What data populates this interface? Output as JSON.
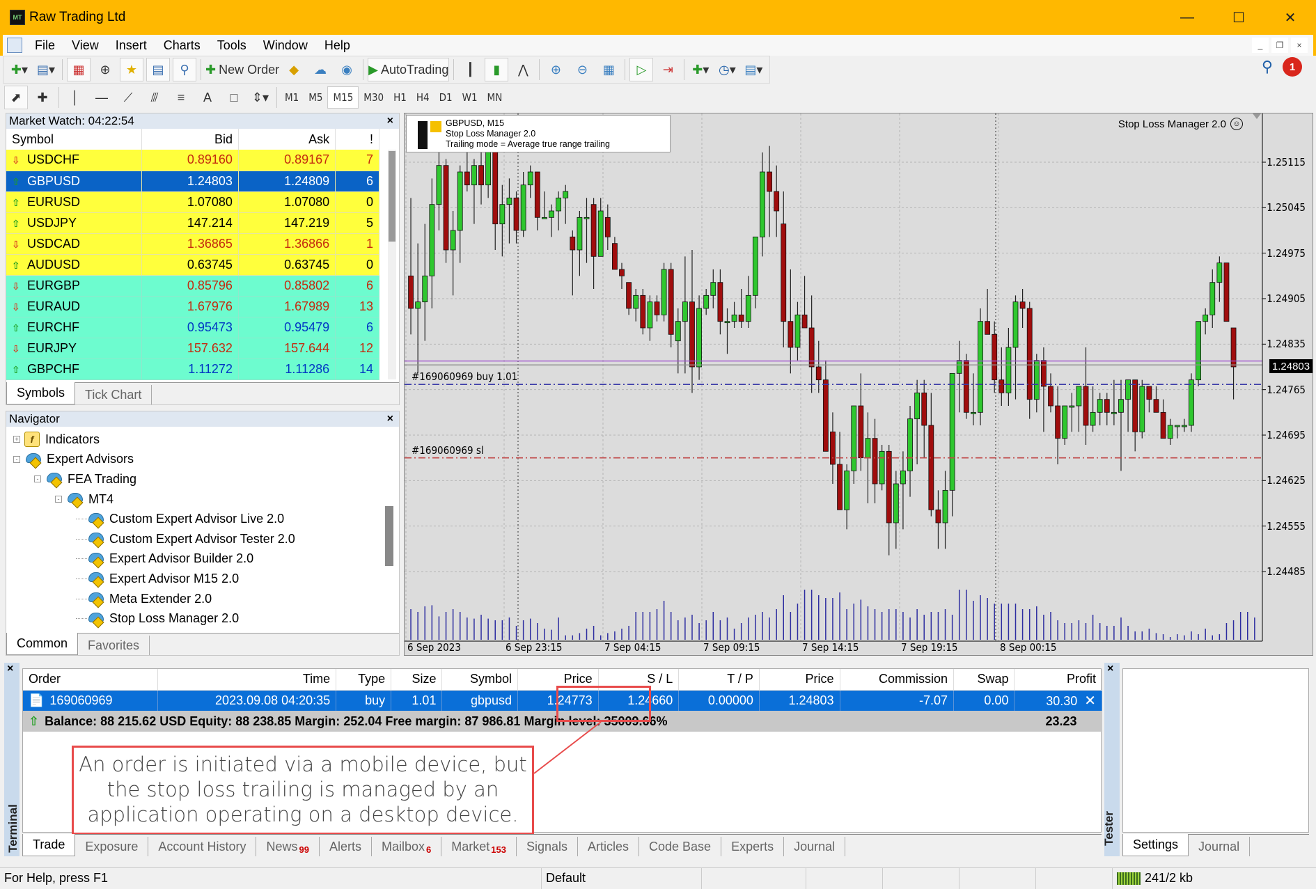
{
  "window": {
    "title": "Raw Trading Ltd",
    "logo_text": "MT"
  },
  "menu": [
    "File",
    "View",
    "Insert",
    "Charts",
    "Tools",
    "Window",
    "Help"
  ],
  "toolbar": {
    "new_order_label": "New Order",
    "autotrading_label": "AutoTrading",
    "notification_count": "1"
  },
  "timeframes": [
    "M1",
    "M5",
    "M15",
    "M30",
    "H1",
    "H4",
    "D1",
    "W1",
    "MN"
  ],
  "timeframe_selected": "M15",
  "market_watch": {
    "title": "Market Watch: 04:22:54",
    "columns": [
      "Symbol",
      "Bid",
      "Ask",
      "!"
    ],
    "rows": [
      {
        "symbol": "USDCHF",
        "bid": "0.89160",
        "ask": "0.89167",
        "spread": "7",
        "dir": "down",
        "group": "yellow",
        "color": "red"
      },
      {
        "symbol": "GBPUSD",
        "bid": "1.24803",
        "ask": "1.24809",
        "spread": "6",
        "dir": "up",
        "group": "selected",
        "color": "white"
      },
      {
        "symbol": "EURUSD",
        "bid": "1.07080",
        "ask": "1.07080",
        "spread": "0",
        "dir": "up",
        "group": "yellow",
        "color": "black"
      },
      {
        "symbol": "USDJPY",
        "bid": "147.214",
        "ask": "147.219",
        "spread": "5",
        "dir": "up",
        "group": "yellow",
        "color": "black"
      },
      {
        "symbol": "USDCAD",
        "bid": "1.36865",
        "ask": "1.36866",
        "spread": "1",
        "dir": "down",
        "group": "yellow",
        "color": "red"
      },
      {
        "symbol": "AUDUSD",
        "bid": "0.63745",
        "ask": "0.63745",
        "spread": "0",
        "dir": "up",
        "group": "yellow",
        "color": "black"
      },
      {
        "symbol": "EURGBP",
        "bid": "0.85796",
        "ask": "0.85802",
        "spread": "6",
        "dir": "down",
        "group": "aqua",
        "color": "red"
      },
      {
        "symbol": "EURAUD",
        "bid": "1.67976",
        "ask": "1.67989",
        "spread": "13",
        "dir": "down",
        "group": "aqua",
        "color": "red"
      },
      {
        "symbol": "EURCHF",
        "bid": "0.95473",
        "ask": "0.95479",
        "spread": "6",
        "dir": "up",
        "group": "aqua",
        "color": "blue"
      },
      {
        "symbol": "EURJPY",
        "bid": "157.632",
        "ask": "157.644",
        "spread": "12",
        "dir": "down",
        "group": "aqua",
        "color": "red"
      },
      {
        "symbol": "GBPCHF",
        "bid": "1.11272",
        "ask": "1.11286",
        "spread": "14",
        "dir": "up",
        "group": "aqua",
        "color": "blue"
      }
    ],
    "tabs": [
      "Symbols",
      "Tick Chart"
    ],
    "active_tab": "Symbols"
  },
  "navigator": {
    "title": "Navigator",
    "nodes": [
      {
        "label": "Indicators",
        "level": 0,
        "icon": "indicator-icon",
        "toggle": "+"
      },
      {
        "label": "Expert Advisors",
        "level": 0,
        "icon": "expert-advisor-icon",
        "toggle": "-"
      },
      {
        "label": "FEA Trading",
        "level": 1,
        "icon": "expert-advisor-icon",
        "toggle": "-"
      },
      {
        "label": "MT4",
        "level": 2,
        "icon": "expert-advisor-icon",
        "toggle": "-"
      },
      {
        "label": "Custom Expert Advisor Live 2.0",
        "level": 3,
        "icon": "expert-advisor-icon",
        "toggle": ""
      },
      {
        "label": "Custom Expert Advisor Tester 2.0",
        "level": 3,
        "icon": "expert-advisor-icon",
        "toggle": ""
      },
      {
        "label": "Expert Advisor Builder 2.0",
        "level": 3,
        "icon": "expert-advisor-icon",
        "toggle": ""
      },
      {
        "label": "Expert Advisor M15 2.0",
        "level": 3,
        "icon": "expert-advisor-icon",
        "toggle": ""
      },
      {
        "label": "Meta Extender 2.0",
        "level": 3,
        "icon": "expert-advisor-icon",
        "toggle": ""
      },
      {
        "label": "Stop Loss Manager 2.0",
        "level": 3,
        "icon": "expert-advisor-icon",
        "toggle": ""
      }
    ],
    "tabs": [
      "Common",
      "Favorites"
    ],
    "active_tab": "Common"
  },
  "chart": {
    "info_line1": "GBPUSD, M15",
    "info_line2": "Stop Loss Manager 2.0",
    "info_line3": "Trailing mode = Average true range trailing",
    "ea_label": "Stop Loss Manager 2.0",
    "ea_status_icon": "smiley-icon",
    "current_price": "1.24803",
    "order_line_label": "#169060969 buy 1.01",
    "sl_line_label": "#169060969 sl"
  },
  "chart_data": {
    "type": "candlestick",
    "symbol": "GBPUSD",
    "timeframe": "M15",
    "y_ticks": [
      "1.25115",
      "1.25045",
      "1.24975",
      "1.24905",
      "1.24835",
      "1.24765",
      "1.24695",
      "1.24625",
      "1.24555",
      "1.24485"
    ],
    "ylim": [
      1.2444,
      1.2519
    ],
    "x_ticks": [
      "6 Sep 2023",
      "6 Sep 23:15",
      "7 Sep 04:15",
      "7 Sep 09:15",
      "7 Sep 14:15",
      "7 Sep 19:15",
      "8 Sep 00:15"
    ],
    "grid": true,
    "lines": [
      {
        "name": "order-open",
        "price": 1.24773,
        "style": "dash-dot",
        "color": "#3c3ca8"
      },
      {
        "name": "stop-loss",
        "price": 1.2466,
        "style": "dash-dot",
        "color": "#c04848"
      },
      {
        "name": "ask",
        "price": 1.24809,
        "style": "solid",
        "color": "#a050d0"
      },
      {
        "name": "bid",
        "price": 1.24803,
        "style": "solid",
        "color": "#909090"
      }
    ],
    "candles": [
      [
        1.2494,
        1.2506,
        1.2485,
        1.2489
      ],
      [
        1.2489,
        1.2499,
        1.2479,
        1.249
      ],
      [
        1.249,
        1.2502,
        1.2484,
        1.2494
      ],
      [
        1.2494,
        1.2509,
        1.2489,
        1.2505
      ],
      [
        1.2505,
        1.2513,
        1.2501,
        1.2511
      ],
      [
        1.2511,
        1.2512,
        1.2496,
        1.2498
      ],
      [
        1.2498,
        1.2504,
        1.2491,
        1.2501
      ],
      [
        1.2501,
        1.2511,
        1.2496,
        1.251
      ],
      [
        1.251,
        1.2514,
        1.2507,
        1.2508
      ],
      [
        1.2508,
        1.2512,
        1.2502,
        1.2511
      ],
      [
        1.2511,
        1.2514,
        1.2505,
        1.2508
      ],
      [
        1.2508,
        1.2515,
        1.2506,
        1.2514
      ],
      [
        1.2514,
        1.2514,
        1.2498,
        1.2502
      ],
      [
        1.2502,
        1.2508,
        1.2497,
        1.2505
      ],
      [
        1.2505,
        1.2509,
        1.2499,
        1.2506
      ],
      [
        1.2506,
        1.2507,
        1.2499,
        1.2501
      ],
      [
        1.2501,
        1.251,
        1.25,
        1.2508
      ],
      [
        1.2508,
        1.2511,
        1.2506,
        1.251
      ],
      [
        1.251,
        1.251,
        1.2501,
        1.2503
      ],
      [
        1.2503,
        1.2507,
        1.2503,
        1.2503
      ],
      [
        1.2503,
        1.2505,
        1.25,
        1.2504
      ],
      [
        1.2504,
        1.2507,
        1.2501,
        1.2506
      ],
      [
        1.2506,
        1.2508,
        1.2502,
        1.2507
      ],
      [
        1.25,
        1.2501,
        1.2491,
        1.2498
      ],
      [
        1.2498,
        1.2504,
        1.2494,
        1.2503
      ],
      [
        1.2503,
        1.2506,
        1.2496,
        1.2503
      ],
      [
        1.2505,
        1.2506,
        1.2492,
        1.2497
      ],
      [
        1.2497,
        1.2506,
        1.2497,
        1.2504
      ],
      [
        1.2503,
        1.2505,
        1.2498,
        1.25
      ],
      [
        1.2499,
        1.25,
        1.2495,
        1.2495
      ],
      [
        1.2495,
        1.2496,
        1.2492,
        1.2494
      ],
      [
        1.2493,
        1.2493,
        1.2488,
        1.2489
      ],
      [
        1.2489,
        1.2492,
        1.2487,
        1.2491
      ],
      [
        1.2491,
        1.2492,
        1.2485,
        1.2486
      ],
      [
        1.2486,
        1.2491,
        1.2484,
        1.249
      ],
      [
        1.249,
        1.2491,
        1.2487,
        1.2488
      ],
      [
        1.2488,
        1.2496,
        1.2487,
        1.2495
      ],
      [
        1.2495,
        1.2496,
        1.2483,
        1.2485
      ],
      [
        1.2484,
        1.2489,
        1.2479,
        1.2487
      ],
      [
        1.2487,
        1.2497,
        1.2479,
        1.249
      ],
      [
        1.249,
        1.2498,
        1.2476,
        1.248
      ],
      [
        1.248,
        1.2491,
        1.2478,
        1.2489
      ],
      [
        1.2489,
        1.2492,
        1.2488,
        1.2491
      ],
      [
        1.2491,
        1.2495,
        1.2489,
        1.2493
      ],
      [
        1.2493,
        1.2495,
        1.2485,
        1.2487
      ],
      [
        1.2487,
        1.2489,
        1.2482,
        1.2487
      ],
      [
        1.2487,
        1.249,
        1.2486,
        1.2488
      ],
      [
        1.2488,
        1.2492,
        1.2486,
        1.2487
      ],
      [
        1.2487,
        1.2494,
        1.2486,
        1.2491
      ],
      [
        1.2491,
        1.2499,
        1.2489,
        1.25
      ],
      [
        1.25,
        1.2513,
        1.2497,
        1.251
      ],
      [
        1.251,
        1.2514,
        1.25,
        1.2507
      ],
      [
        1.2507,
        1.2511,
        1.25,
        1.2504
      ],
      [
        1.2502,
        1.2507,
        1.2483,
        1.2487
      ],
      [
        1.2487,
        1.2495,
        1.2479,
        1.2483
      ],
      [
        1.2483,
        1.249,
        1.2481,
        1.2488
      ],
      [
        1.2488,
        1.2494,
        1.2486,
        1.2486
      ],
      [
        1.2486,
        1.2491,
        1.2476,
        1.248
      ],
      [
        1.248,
        1.2484,
        1.2476,
        1.2478
      ],
      [
        1.2478,
        1.2481,
        1.2468,
        1.2467
      ],
      [
        1.247,
        1.2473,
        1.2462,
        1.2465
      ],
      [
        1.2465,
        1.247,
        1.2459,
        1.2458
      ],
      [
        1.2458,
        1.2465,
        1.2455,
        1.2464
      ],
      [
        1.2464,
        1.2474,
        1.2462,
        1.2474
      ],
      [
        1.2474,
        1.2479,
        1.2464,
        1.2466
      ],
      [
        1.2466,
        1.2473,
        1.2459,
        1.2469
      ],
      [
        1.2469,
        1.2472,
        1.2459,
        1.2462
      ],
      [
        1.2462,
        1.2468,
        1.2461,
        1.2467
      ],
      [
        1.2467,
        1.2468,
        1.2451,
        1.2456
      ],
      [
        1.2456,
        1.2464,
        1.2452,
        1.2462
      ],
      [
        1.2462,
        1.2467,
        1.2455,
        1.2464
      ],
      [
        1.2464,
        1.2474,
        1.246,
        1.2472
      ],
      [
        1.2472,
        1.2478,
        1.2465,
        1.2476
      ],
      [
        1.2476,
        1.2478,
        1.2466,
        1.2471
      ],
      [
        1.2471,
        1.2476,
        1.2457,
        1.2458
      ],
      [
        1.2458,
        1.2461,
        1.2452,
        1.2456
      ],
      [
        1.2456,
        1.2464,
        1.2452,
        1.2461
      ],
      [
        1.2461,
        1.2479,
        1.2457,
        1.2479
      ],
      [
        1.2479,
        1.2484,
        1.2473,
        1.2481
      ],
      [
        1.2481,
        1.2482,
        1.2472,
        1.2473
      ],
      [
        1.2473,
        1.2479,
        1.2471,
        1.2473
      ],
      [
        1.2473,
        1.2489,
        1.2471,
        1.2487
      ],
      [
        1.2487,
        1.2492,
        1.2485,
        1.2485
      ],
      [
        1.2485,
        1.2487,
        1.2476,
        1.2478
      ],
      [
        1.2478,
        1.2483,
        1.2474,
        1.2476
      ],
      [
        1.2476,
        1.2486,
        1.2474,
        1.2483
      ],
      [
        1.2483,
        1.2491,
        1.2475,
        1.249
      ],
      [
        1.249,
        1.2492,
        1.2486,
        1.2489
      ],
      [
        1.2489,
        1.249,
        1.2472,
        1.2475
      ],
      [
        1.2475,
        1.2482,
        1.2473,
        1.2481
      ],
      [
        1.2481,
        1.2483,
        1.247,
        1.2477
      ],
      [
        1.2477,
        1.2479,
        1.2473,
        1.2474
      ],
      [
        1.2474,
        1.2477,
        1.2465,
        1.2469
      ],
      [
        1.2469,
        1.2474,
        1.2468,
        1.2474
      ],
      [
        1.2474,
        1.2476,
        1.247,
        1.2474
      ],
      [
        1.2474,
        1.2477,
        1.247,
        1.2477
      ],
      [
        1.2477,
        1.2483,
        1.2468,
        1.2471
      ],
      [
        1.2471,
        1.2477,
        1.247,
        1.2473
      ],
      [
        1.2473,
        1.2476,
        1.2471,
        1.2475
      ],
      [
        1.2475,
        1.2476,
        1.2471,
        1.2473
      ],
      [
        1.2473,
        1.2478,
        1.2471,
        1.2473
      ],
      [
        1.2473,
        1.2478,
        1.2464,
        1.2475
      ],
      [
        1.2475,
        1.2478,
        1.247,
        1.2478
      ],
      [
        1.2478,
        1.2478,
        1.2467,
        1.247
      ],
      [
        1.247,
        1.2478,
        1.2469,
        1.2477
      ],
      [
        1.2477,
        1.2477,
        1.2473,
        1.2475
      ],
      [
        1.2475,
        1.2477,
        1.2473,
        1.2473
      ],
      [
        1.2473,
        1.2475,
        1.2469,
        1.2469
      ],
      [
        1.2469,
        1.2472,
        1.2468,
        1.2471
      ],
      [
        1.2471,
        1.2471,
        1.2469,
        1.2471
      ],
      [
        1.2471,
        1.2472,
        1.247,
        1.2471
      ],
      [
        1.2471,
        1.2479,
        1.247,
        1.2478
      ],
      [
        1.2478,
        1.2485,
        1.2477,
        1.2487
      ],
      [
        1.2487,
        1.2489,
        1.2485,
        1.2488
      ],
      [
        1.2488,
        1.2495,
        1.2486,
        1.2493
      ],
      [
        1.2493,
        1.2497,
        1.249,
        1.2496
      ],
      [
        1.2496,
        1.2496,
        1.2487,
        1.2487
      ],
      [
        1.2486,
        1.2486,
        1.2475,
        1.248
      ]
    ],
    "volume_relative": [
      0.55,
      0.5,
      0.6,
      0.62,
      0.42,
      0.5,
      0.55,
      0.5,
      0.4,
      0.38,
      0.45,
      0.38,
      0.35,
      0.35,
      0.4,
      0.25,
      0.35,
      0.38,
      0.3,
      0.2,
      0.18,
      0.4,
      0.08,
      0.08,
      0.12,
      0.2,
      0.25,
      0.08,
      0.12,
      0.15,
      0.2,
      0.25,
      0.5,
      0.5,
      0.5,
      0.55,
      0.7,
      0.5,
      0.35,
      0.4,
      0.45,
      0.3,
      0.35,
      0.5,
      0.35,
      0.4,
      0.2,
      0.3,
      0.4,
      0.45,
      0.5,
      0.4,
      0.55,
      0.8,
      0.5,
      0.65,
      0.9,
      0.9,
      0.8,
      0.75,
      0.75,
      0.85,
      0.55,
      0.65,
      0.72,
      0.6,
      0.55,
      0.5,
      0.55,
      0.55,
      0.5,
      0.4,
      0.55,
      0.45,
      0.5,
      0.5,
      0.55,
      0.45,
      0.9,
      0.9,
      0.7,
      0.8,
      0.75,
      0.65,
      0.65,
      0.65,
      0.65,
      0.55,
      0.55,
      0.6,
      0.45,
      0.5,
      0.35,
      0.3,
      0.3,
      0.35,
      0.3,
      0.45,
      0.3,
      0.25,
      0.25,
      0.4,
      0.25,
      0.15,
      0.15,
      0.2,
      0.12,
      0.1,
      0.05,
      0.1,
      0.08,
      0.15,
      0.1,
      0.2,
      0.08,
      0.1,
      0.3,
      0.35,
      0.5,
      0.5,
      0.4
    ]
  },
  "terminal": {
    "side_label": "Terminal",
    "columns": [
      "Order",
      "Time",
      "Type",
      "Size",
      "Symbol",
      "Price",
      "S / L",
      "T / P",
      "Price",
      "Commission",
      "Swap",
      "Profit"
    ],
    "order": {
      "order": "169060969",
      "time": "2023.09.08 04:20:35",
      "type": "buy",
      "size": "1.01",
      "symbol": "gbpusd",
      "price": "1.24773",
      "sl": "1.24660",
      "tp": "0.00000",
      "cur_price": "1.24803",
      "commission": "-7.07",
      "swap": "0.00",
      "profit": "30.30"
    },
    "balance_line": "Balance: 88 215.62 USD  Equity: 88 238.85  Margin: 252.04  Free margin: 87 986.81  Margin level: 35009.66%",
    "total_profit": "23.23",
    "tabs": [
      {
        "label": "Trade",
        "count": ""
      },
      {
        "label": "Exposure",
        "count": ""
      },
      {
        "label": "Account History",
        "count": ""
      },
      {
        "label": "News",
        "count": "99"
      },
      {
        "label": "Alerts",
        "count": ""
      },
      {
        "label": "Mailbox",
        "count": "6"
      },
      {
        "label": "Market",
        "count": "153"
      },
      {
        "label": "Signals",
        "count": ""
      },
      {
        "label": "Articles",
        "count": ""
      },
      {
        "label": "Code Base",
        "count": ""
      },
      {
        "label": "Experts",
        "count": ""
      },
      {
        "label": "Journal",
        "count": ""
      }
    ],
    "active_tab": "Trade"
  },
  "annotation": {
    "text": "An order is initiated via a mobile device, but the stop loss trailing is managed by an application operating on a desktop device.",
    "color": "#e84b4b"
  },
  "tester": {
    "side_label": "Tester",
    "tabs": [
      "Settings",
      "Journal"
    ],
    "active_tab": "Settings"
  },
  "status": {
    "help": "For Help, press F1",
    "profile": "Default",
    "traffic": "241/2 kb"
  }
}
